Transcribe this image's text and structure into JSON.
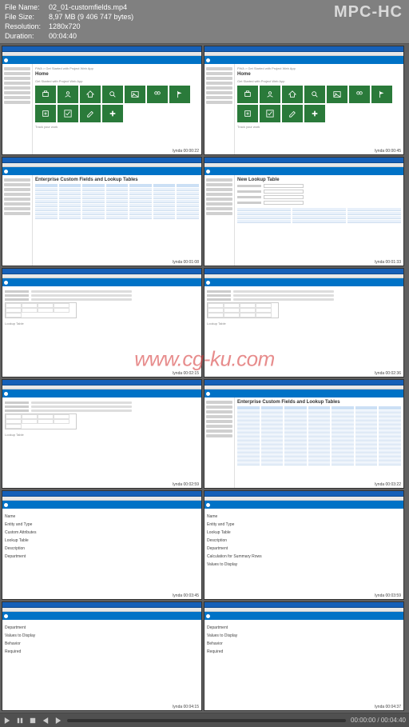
{
  "player": {
    "name": "MPC-HC",
    "info": {
      "filename_label": "File Name:",
      "filename": "02_01-customfields.mp4",
      "filesize_label": "File Size:",
      "filesize": "8,97 MB (9 406 747 bytes)",
      "resolution_label": "Resolution:",
      "resolution": "1280x720",
      "duration_label": "Duration:",
      "duration": "00:04:40"
    },
    "position": "00:00:00",
    "total": "00:04:40"
  },
  "watermark": "www.cg-ku.com",
  "thumbnails": [
    {
      "kind": "home",
      "title": "Home",
      "subtitle": "PWA > Get Started with Project Web App",
      "tiles": [
        "portfolio",
        "resources",
        "home",
        "search",
        "picture",
        "people",
        "flag",
        "new",
        "check",
        "edit",
        "add"
      ],
      "timestamp": "lynda 00:00:22"
    },
    {
      "kind": "home",
      "title": "Home",
      "subtitle": "PWA > Get Started with Project Web App",
      "tiles": [
        "portfolio",
        "resources",
        "home",
        "search",
        "picture",
        "people",
        "flag",
        "new",
        "check",
        "edit",
        "add"
      ],
      "timestamp": "lynda 00:00:45"
    },
    {
      "kind": "table",
      "title": "Enterprise Custom Fields and Lookup Tables",
      "columns": [
        "Field",
        "Entity",
        "Type",
        "Required",
        "Formula",
        "Lookup Table",
        "Last Modified"
      ],
      "rows": 8,
      "timestamp": "lynda 00:01:08"
    },
    {
      "kind": "newlookup",
      "title": "New Lookup Table",
      "subtitle": "",
      "fields": [
        "Name",
        "Type",
        "Code Mask",
        "Lookup Table"
      ],
      "timestamp": "lynda 00:01:33"
    },
    {
      "kind": "form-grid",
      "title": "",
      "fields": [
        "Name",
        "Type",
        "Description"
      ],
      "gridrows": 3,
      "timestamp": "lynda 00:02:15"
    },
    {
      "kind": "form-grid",
      "title": "",
      "fields": [
        "Name",
        "Type",
        "Description"
      ],
      "gridrows": 4,
      "timestamp": "lynda 00:02:36"
    },
    {
      "kind": "form-grid",
      "title": "",
      "fields": [
        "Name",
        "Type",
        "Description"
      ],
      "gridrows": 3,
      "timestamp": "lynda 00:02:59"
    },
    {
      "kind": "bigtable",
      "title": "Enterprise Custom Fields and Lookup Tables",
      "columns": [
        "Field",
        "Entity",
        "Type",
        "Required",
        "Graphical Indicators",
        "Lookup Table",
        "Last Modified"
      ],
      "rows": 14,
      "timestamp": "lynda 00:03:22"
    },
    {
      "kind": "newfield",
      "title": "",
      "sections": [
        "Name",
        "Entity and Type",
        "Custom Attributes",
        "Lookup Table",
        "Description",
        "Department"
      ],
      "timestamp": "lynda 00:03:45"
    },
    {
      "kind": "newfield",
      "title": "",
      "sections": [
        "Name",
        "Entity and Type",
        "Lookup Table",
        "Description",
        "Department",
        "Calculation for Summary Rows",
        "Values to Display"
      ],
      "timestamp": "lynda 00:03:59"
    },
    {
      "kind": "newfield2",
      "title": "",
      "sections": [
        "Department",
        "Values to Display",
        "Behavior",
        "Required"
      ],
      "timestamp": "lynda 00:04:15"
    },
    {
      "kind": "newfield2",
      "title": "",
      "sections": [
        "Department",
        "Values to Display",
        "Behavior",
        "Required"
      ],
      "timestamp": "lynda 00:04:37"
    }
  ]
}
